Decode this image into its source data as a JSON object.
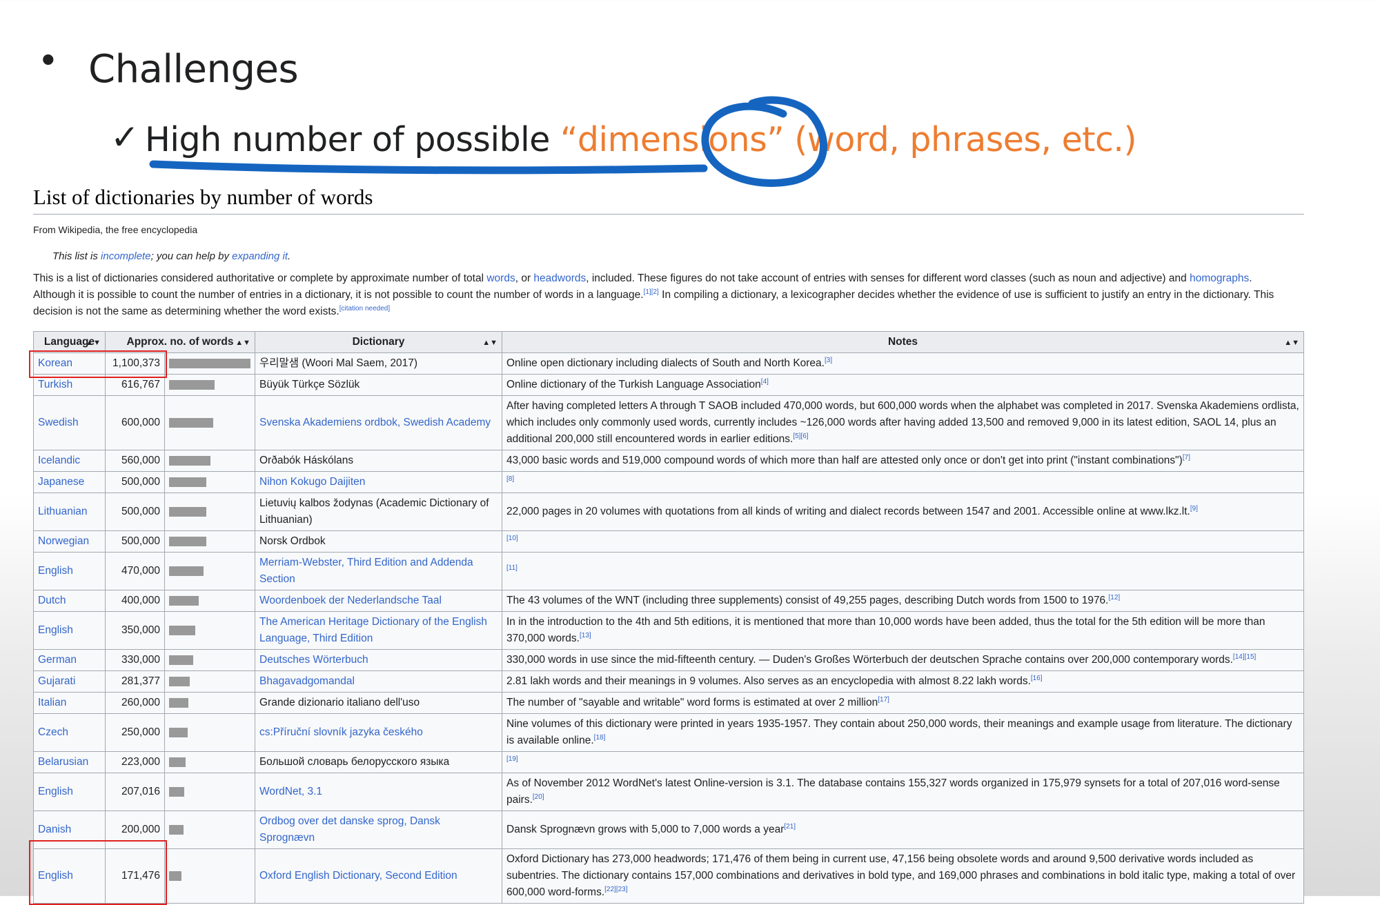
{
  "slide": {
    "bullet": "•",
    "heading": "Challenges",
    "check": "✓",
    "sub_black": "High number of possible ",
    "sub_orange": "“dimensions” (word, phrases, etc.)",
    "accent": "#ed7d31",
    "annotation_color": "#1565c0"
  },
  "article": {
    "title": "List of dictionaries by number of words",
    "from": "From Wikipedia, the free encyclopedia",
    "hatnote_a": "This list is ",
    "hatnote_link1": "incomplete",
    "hatnote_b": "; you can help by ",
    "hatnote_link2": "expanding it",
    "hatnote_c": ".",
    "intro_1": "This is a list of dictionaries considered authoritative or complete by approximate number of total ",
    "intro_link_words": "words",
    "intro_2": ", or ",
    "intro_link_headwords": "headwords",
    "intro_3": ", included. These figures do not take account of entries with senses for different word classes (such as noun and adjective) and ",
    "intro_link_homographs": "homographs",
    "intro_4": ". Although it is possible to count the number of entries in a dictionary, it is not possible to count the number of words in a language.",
    "intro_sup1": "[1][2]",
    "intro_5": " In compiling a dictionary, a lexicographer decides whether the evidence of use is sufficient to justify an entry in the dictionary. This decision is not the same as determining whether the word exists.",
    "intro_sup2": "[citation needed]"
  },
  "table": {
    "headers": [
      "Language",
      "Approx. no. of words",
      "Dictionary",
      "Notes"
    ],
    "sort_icon": "▲▼",
    "max_words": 1100373,
    "rows": [
      {
        "lang": "Korean",
        "words": "1,100,373",
        "value": 1100373,
        "dict": "우리말샘 (Woori Mal Saem, 2017)",
        "dict_link": false,
        "notes": "Online open dictionary including dialects of South and North Korea.",
        "sup": "[3]"
      },
      {
        "lang": "Turkish",
        "words": "616,767",
        "value": 616767,
        "dict": "Büyük Türkçe Sözlük",
        "dict_link": false,
        "notes": "Online dictionary of the Turkish Language Association",
        "sup": "[4]"
      },
      {
        "lang": "Swedish",
        "words": "600,000",
        "value": 600000,
        "dict": "Svenska Akademiens ordbok, Swedish Academy",
        "dict_link": true,
        "notes": "After having completed letters A through T SAOB included 470,000 words, but 600,000 words when the alphabet was completed in 2017. Svenska Akademiens ordlista, which includes only commonly used words, currently includes ~126,000 words after having added 13,500 and removed 9,000 in its latest edition, SAOL 14, plus an additional 200,000 still encountered words in earlier editions.",
        "sup": "[5][6]"
      },
      {
        "lang": "Icelandic",
        "words": "560,000",
        "value": 560000,
        "dict": "Orðabók Háskólans",
        "dict_link": false,
        "notes": "43,000 basic words and 519,000 compound words of which more than half are attested only once or don't get into print (\"instant combinations\")",
        "sup": "[7]"
      },
      {
        "lang": "Japanese",
        "words": "500,000",
        "value": 500000,
        "dict": "Nihon Kokugo Daijiten",
        "dict_link": true,
        "notes": "",
        "sup": "[8]"
      },
      {
        "lang": "Lithuanian",
        "words": "500,000",
        "value": 500000,
        "dict": "Lietuvių kalbos žodynas (Academic Dictionary of Lithuanian)",
        "dict_link": false,
        "notes": "22,000 pages in 20 volumes with quotations from all kinds of writing and dialect records between 1547 and 2001. Accessible online at www.lkz.lt.",
        "sup": "[9]"
      },
      {
        "lang": "Norwegian",
        "words": "500,000",
        "value": 500000,
        "dict": "Norsk Ordbok",
        "dict_link": false,
        "notes": "",
        "sup": "[10]"
      },
      {
        "lang": "English",
        "words": "470,000",
        "value": 470000,
        "dict": "Merriam-Webster, Third Edition and Addenda Section",
        "dict_link": true,
        "notes": "",
        "sup": "[11]"
      },
      {
        "lang": "Dutch",
        "words": "400,000",
        "value": 400000,
        "dict": "Woordenboek der Nederlandsche Taal",
        "dict_link": true,
        "notes": "The 43 volumes of the WNT (including three supplements) consist of 49,255 pages, describing Dutch words from 1500 to 1976.",
        "sup": "[12]"
      },
      {
        "lang": "English",
        "words": "350,000",
        "value": 350000,
        "dict": "The American Heritage Dictionary of the English Language, Third Edition",
        "dict_link": true,
        "notes": "In in the introduction to the 4th and 5th editions, it is mentioned that more than 10,000 words have been added, thus the total for the 5th edition will be more than 370,000 words.",
        "sup": "[13]"
      },
      {
        "lang": "German",
        "words": "330,000",
        "value": 330000,
        "dict": "Deutsches Wörterbuch",
        "dict_link": true,
        "notes": "330,000 words in use since the mid-fifteenth century. — Duden's Großes Wörterbuch der deutschen Sprache contains over 200,000 contemporary words.",
        "sup": "[14][15]"
      },
      {
        "lang": "Gujarati",
        "words": "281,377",
        "value": 281377,
        "dict": "Bhagavadgomandal",
        "dict_link": true,
        "notes": "2.81 lakh words and their meanings in 9 volumes. Also serves as an encyclopedia with almost 8.22 lakh words.",
        "sup": "[16]"
      },
      {
        "lang": "Italian",
        "words": "260,000",
        "value": 260000,
        "dict": "Grande dizionario italiano dell'uso",
        "dict_link": false,
        "notes": "The number of \"sayable and writable\" word forms is estimated at over 2 million",
        "sup": "[17]"
      },
      {
        "lang": "Czech",
        "words": "250,000",
        "value": 250000,
        "dict": "cs:Příruční slovník jazyka českého",
        "dict_link": true,
        "notes": "Nine volumes of this dictionary were printed in years 1935-1957. They contain about 250,000 words, their meanings and example usage from literature. The dictionary is available online.",
        "sup": "[18]"
      },
      {
        "lang": "Belarusian",
        "words": "223,000",
        "value": 223000,
        "dict": "Большой словарь белорусского языка",
        "dict_link": false,
        "notes": "",
        "sup": "[19]"
      },
      {
        "lang": "English",
        "words": "207,016",
        "value": 207016,
        "dict": "WordNet, 3.1",
        "dict_link": true,
        "notes": "As of November 2012 WordNet's latest Online-version is 3.1. The database contains 155,327 words organized in 175,979 synsets for a total of 207,016 word-sense pairs.",
        "sup": "[20]"
      },
      {
        "lang": "Danish",
        "words": "200,000",
        "value": 200000,
        "dict": "Ordbog over det danske sprog, Dansk Sprognævn",
        "dict_link": true,
        "notes": "Dansk Sprognævn grows with 5,000 to 7,000 words a year",
        "sup": "[21]"
      },
      {
        "lang": "English",
        "words": "171,476",
        "value": 171476,
        "dict": "Oxford English Dictionary, Second Edition",
        "dict_link": true,
        "notes": "Oxford Dictionary has 273,000 headwords; 171,476 of them being in current use, 47,156 being obsolete words and around 9,500 derivative words included as subentries. The dictionary contains 157,000 combinations and derivatives in bold type, and 169,000 phrases and combinations in bold italic type, making a total of over 600,000 word-forms.",
        "sup": "[22][23]"
      }
    ]
  }
}
